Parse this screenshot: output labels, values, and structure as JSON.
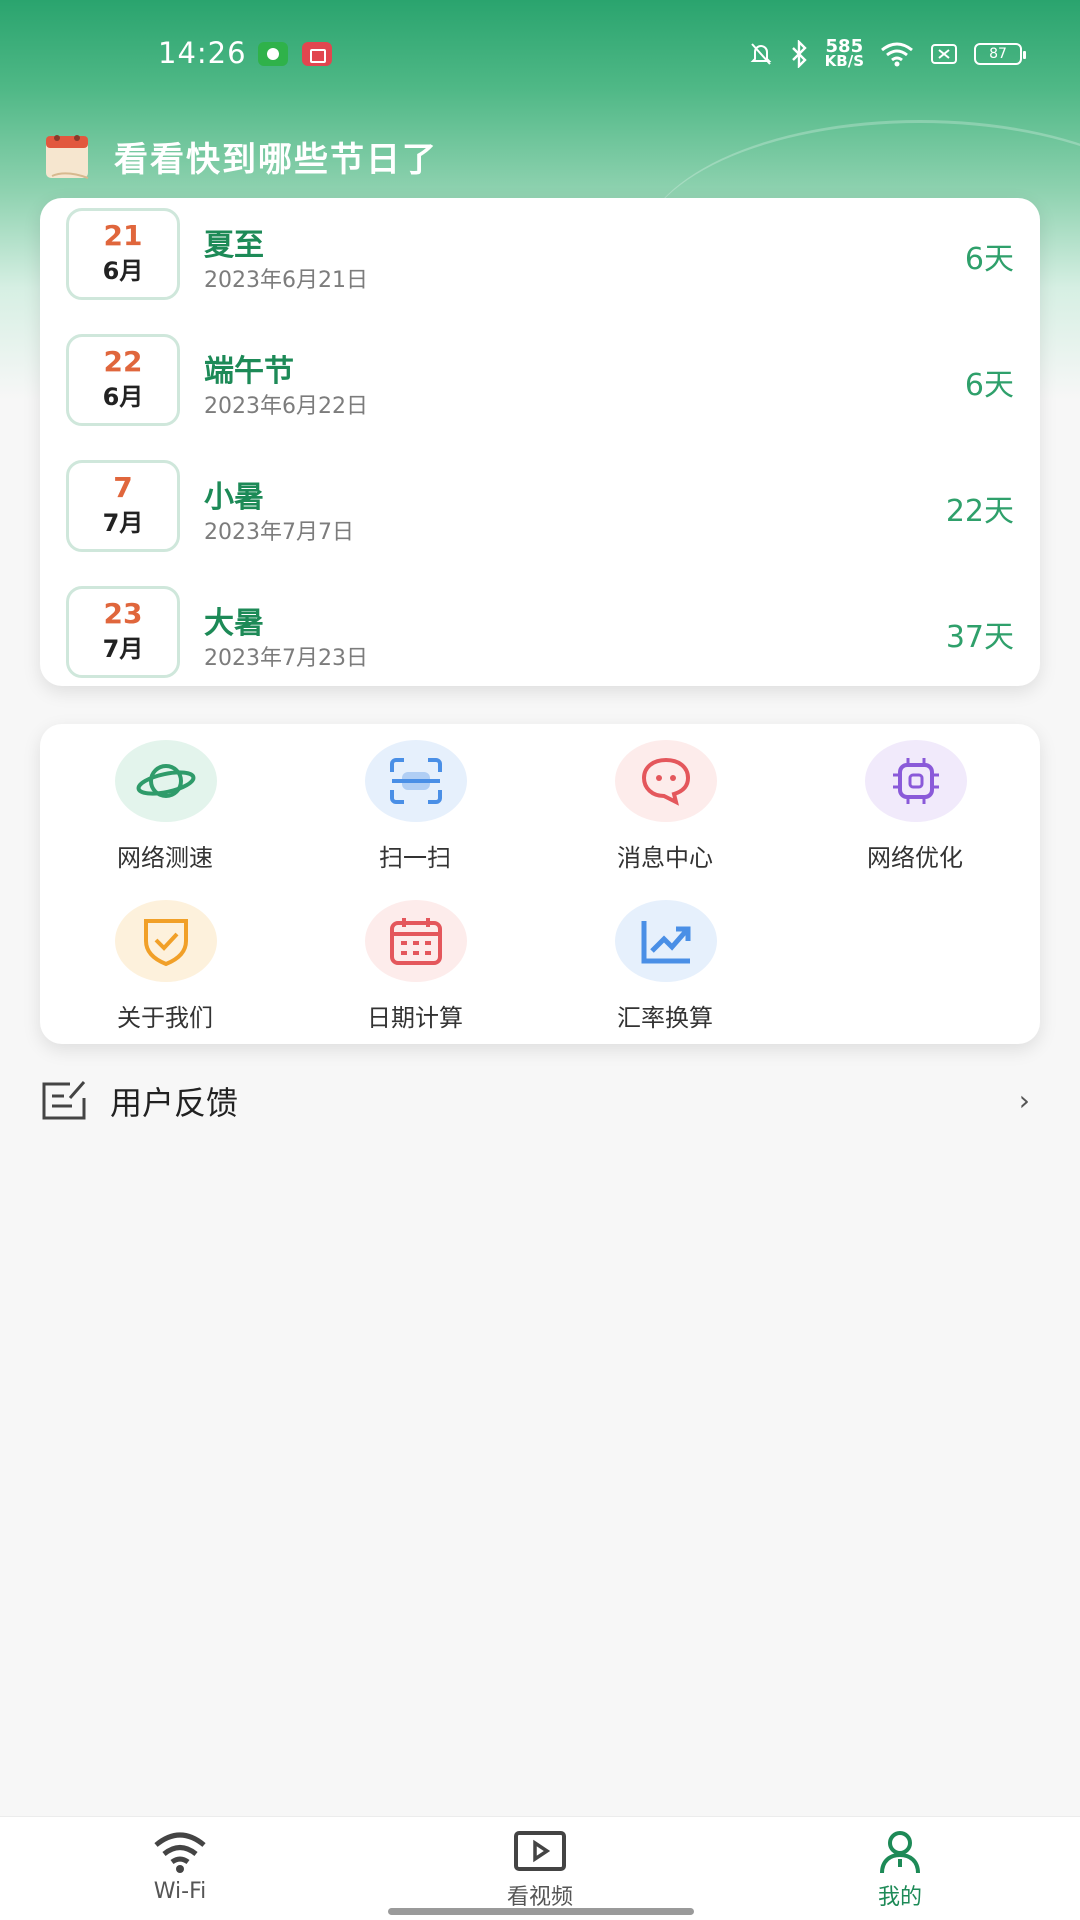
{
  "status_bar": {
    "time": "14:26",
    "net_speed_value": "585",
    "net_speed_unit": "KB/S",
    "battery": "87",
    "icons": [
      "shield-badge-icon",
      "screen-record-icon",
      "mute-icon",
      "bluetooth-icon",
      "wifi-icon",
      "sim-icon",
      "battery-icon"
    ]
  },
  "section": {
    "title": "看看快到哪些节日了",
    "icon": "calendar-icon"
  },
  "festivals": [
    {
      "day": "21",
      "month": "6月",
      "name": "夏至",
      "date": "2023年6月21日",
      "days_left": "6天"
    },
    {
      "day": "22",
      "month": "6月",
      "name": "端午节",
      "date": "2023年6月22日",
      "days_left": "6天"
    },
    {
      "day": "7",
      "month": "7月",
      "name": "小暑",
      "date": "2023年7月7日",
      "days_left": "22天"
    },
    {
      "day": "23",
      "month": "7月",
      "name": "大暑",
      "date": "2023年7月23日",
      "days_left": "37天"
    }
  ],
  "tools": [
    {
      "label": "网络测速",
      "icon": "planet-icon",
      "color": "#2f9b6a",
      "bg": "#e3f4ec"
    },
    {
      "label": "扫一扫",
      "icon": "scan-icon",
      "color": "#4a8fe6",
      "bg": "#e6f0fc"
    },
    {
      "label": "消息中心",
      "icon": "message-icon",
      "color": "#e4575c",
      "bg": "#fdeceb"
    },
    {
      "label": "网络优化",
      "icon": "chip-icon",
      "color": "#8a5ad9",
      "bg": "#f1eafb"
    },
    {
      "label": "关于我们",
      "icon": "shield-check-icon",
      "color": "#f1a028",
      "bg": "#fdf1dc"
    },
    {
      "label": "日期计算",
      "icon": "calendar-grid-icon",
      "color": "#e4575c",
      "bg": "#fdeceb"
    },
    {
      "label": "汇率换算",
      "icon": "trend-chart-icon",
      "color": "#4a8fe6",
      "bg": "#e6f0fc"
    }
  ],
  "feedback": {
    "label": "用户反馈",
    "icon": "edit-note-icon"
  },
  "bottom_nav": [
    {
      "label": "Wi-Fi",
      "icon": "wifi-icon",
      "active": false
    },
    {
      "label": "看视频",
      "icon": "video-play-icon",
      "active": false
    },
    {
      "label": "我的",
      "icon": "user-icon",
      "active": true
    }
  ],
  "colors": {
    "brand_green": "#1d8a57",
    "header_gradient_top": "#2aa46e",
    "date_day_orange": "#e0663c",
    "days_left_green": "#2fa06b"
  }
}
